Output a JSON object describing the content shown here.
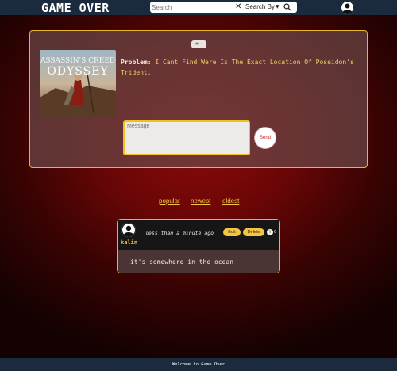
{
  "header": {
    "brand": "GAME OVER",
    "search": {
      "placeholder": "Search",
      "value": "",
      "clear_icon": "close-icon",
      "filter_label": "Search By",
      "filter_icon": "chevron-down-icon",
      "submit_icon": "search-icon"
    },
    "avatar_icon": "user-avatar-icon"
  },
  "problem": {
    "toggle_icon": "plus-minus-icon",
    "label": "Problem:",
    "text": "I Cant Find Were Is The Exact Location Of Poseidon's Trident.",
    "game_cover": {
      "title": "ASSASSIN'S CREED",
      "subtitle": "ODYSSEY"
    },
    "message": {
      "placeholder": "Message",
      "value": ""
    },
    "send_label": "Send"
  },
  "sort": {
    "options": [
      "popular",
      "newest",
      "oldest"
    ]
  },
  "comment": {
    "user": "kalin",
    "time": "less than a minute ago",
    "edit_label": "Edit",
    "delete_label": "Delete",
    "like_icon": "plus-icon",
    "likes": "0",
    "text": "it's somewhere in the ocean"
  },
  "footer": {
    "text": "Welcome to Game Over"
  },
  "colors": {
    "accent": "#f4c542",
    "header_bg": "#1b2a3d",
    "send_text": "#c62020"
  }
}
